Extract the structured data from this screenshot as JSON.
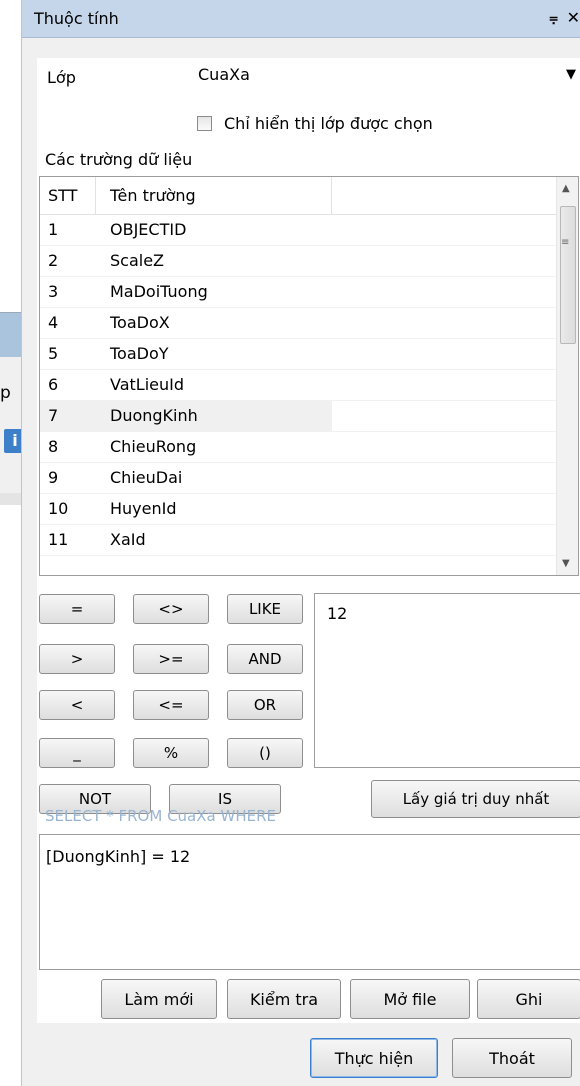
{
  "background_window": {
    "partial_text": "p",
    "info_icon_letter": "i"
  },
  "panel": {
    "title": "Thuộc tính"
  },
  "layer": {
    "label": "Lớp",
    "value": "CuaXa"
  },
  "checkbox": {
    "label": "Chỉ hiển thị lớp được chọn",
    "checked": false
  },
  "fields_section": {
    "label": "Các trường dữ liệu"
  },
  "fields_table": {
    "headers": [
      "STT",
      "Tên trường"
    ],
    "rows": [
      {
        "stt": "1",
        "name": "OBJECTID"
      },
      {
        "stt": "2",
        "name": "ScaleZ"
      },
      {
        "stt": "3",
        "name": "MaDoiTuong"
      },
      {
        "stt": "4",
        "name": "ToaDoX"
      },
      {
        "stt": "5",
        "name": "ToaDoY"
      },
      {
        "stt": "6",
        "name": "VatLieuId"
      },
      {
        "stt": "7",
        "name": "DuongKinh"
      },
      {
        "stt": "8",
        "name": "ChieuRong"
      },
      {
        "stt": "9",
        "name": "ChieuDai"
      },
      {
        "stt": "10",
        "name": "HuyenId"
      },
      {
        "stt": "11",
        "name": "XaId"
      }
    ],
    "selected_row": 7
  },
  "operators": {
    "eq": "=",
    "neq": "<>",
    "like": "LIKE",
    "gt": ">",
    "gte": ">=",
    "and": "AND",
    "lt": "<",
    "lte": "<=",
    "or": "OR",
    "underscore": "_",
    "percent": "%",
    "parens": "()",
    "not": "NOT",
    "is": "IS"
  },
  "unique_values": {
    "items": [
      "12"
    ],
    "button_label": "Lấy giá trị duy nhất"
  },
  "query": {
    "prefix": "SELECT * FROM CuaXa WHERE",
    "expression": "[DuongKinh] = 12"
  },
  "actions": {
    "refresh": "Làm mới",
    "verify": "Kiểm tra",
    "open_file": "Mở file",
    "save": "Ghi",
    "execute": "Thực hiện",
    "exit": "Thoát"
  },
  "colors": {
    "titlebar": "#c6d6ea",
    "sql_label": "#99b4d1",
    "focus": "#3b7fcc"
  }
}
